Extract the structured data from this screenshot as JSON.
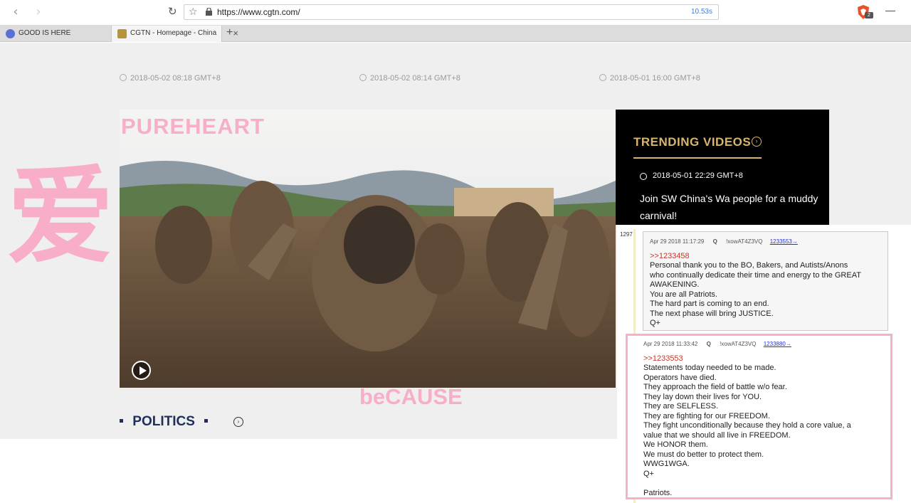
{
  "browser": {
    "url": "https://www.cgtn.com/",
    "timer": "10.53s",
    "badge": "2",
    "tabs": [
      {
        "label": "GOOD IS HERE"
      },
      {
        "label": "CGTN - Homepage - China"
      }
    ],
    "new_tab": "+",
    "tab_close": "×"
  },
  "page": {
    "dates": [
      "2018-05-02 08:18 GMT+8",
      "2018-05-02 08:14 GMT+8",
      "2018-05-01 16:00 GMT+8"
    ],
    "trending": {
      "title": "TRENDING VIDEOS",
      "date": "2018-05-01 22:29 GMT+8",
      "headline": "Join SW China's Wa people for a muddy carnival!"
    },
    "section": "POLITICS"
  },
  "overlay": {
    "chinese": "爱",
    "pureheart": "PUREHEART",
    "because": "beCAUSE"
  },
  "posts": {
    "number": "1297",
    "post1": {
      "date": "Apr 29 2018 11:17:29",
      "q": "Q",
      "id": "!xowAT4Z3VQ",
      "link": "1233553→",
      "reply": ">>1233458",
      "lines": [
        "Personal thank you to the BO, Bakers, and Autists/Anons",
        "who continually dedicate their time and energy to the GREAT",
        "AWAKENING.",
        "You are all Patriots.",
        "The hard part is coming to an end.",
        "The next phase will bring JUSTICE.",
        "Q+"
      ]
    },
    "post2": {
      "date": "Apr 29 2018 11:33:42",
      "q": "Q",
      "id": "!xowAT4Z3VQ",
      "link": "1233880→",
      "reply": ">>1233553",
      "lines": [
        "Statements today needed to be made.",
        "Operators have died.",
        "They approach the field of battle w/o fear.",
        "They lay down their lives for YOU.",
        "They are SELFLESS.",
        "They are fighting for our FREEDOM.",
        "They fight unconditionally because they hold a core value, a",
        "value that we should all live in FREEDOM.",
        "We HONOR them.",
        "We must do better to protect them.",
        "WWG1WGA.",
        "Q+",
        "",
        "Patriots."
      ]
    }
  }
}
